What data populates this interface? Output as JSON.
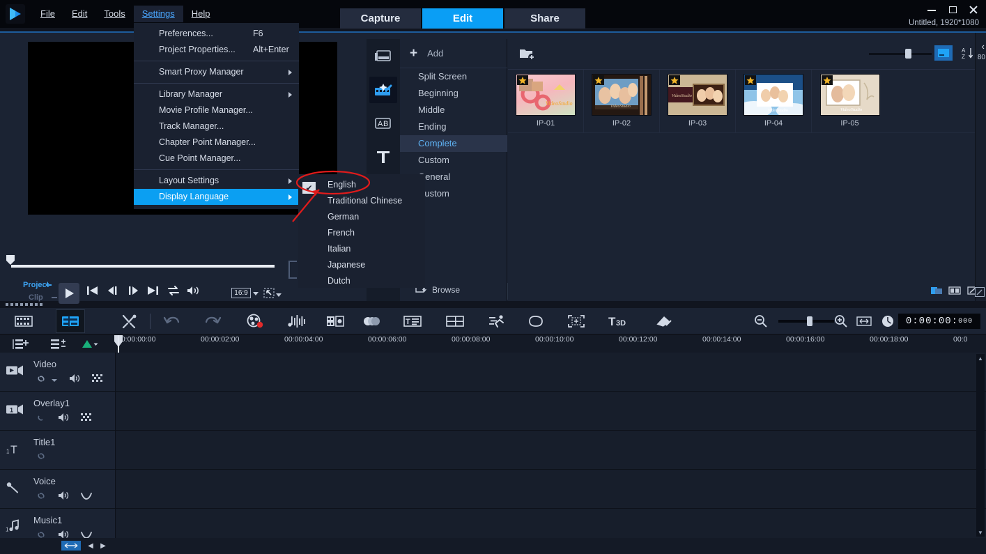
{
  "app": {
    "logo_icon": "play-triangle-logo",
    "project_name": "Untitled, 1920*1080"
  },
  "menubar": {
    "items": [
      {
        "label": "File",
        "active": false
      },
      {
        "label": "Edit",
        "active": false
      },
      {
        "label": "Tools",
        "active": false
      },
      {
        "label": "Settings",
        "active": true
      },
      {
        "label": "Help",
        "active": false
      }
    ]
  },
  "tabs": [
    {
      "label": "Capture",
      "selected": false
    },
    {
      "label": "Edit",
      "selected": true
    },
    {
      "label": "Share",
      "selected": false
    }
  ],
  "window_controls": [
    {
      "name": "minimize-button",
      "icon": "minimize-icon"
    },
    {
      "name": "maximize-button",
      "icon": "maximize-icon"
    },
    {
      "name": "close-button",
      "icon": "close-icon"
    }
  ],
  "settings_menu": {
    "items": [
      {
        "label": "Preferences...",
        "shortcut": "F6",
        "submenu": false,
        "highlight": false
      },
      {
        "label": "Project Properties...",
        "shortcut": "Alt+Enter",
        "submenu": false,
        "highlight": false
      },
      {
        "sep": true
      },
      {
        "label": "Smart Proxy Manager",
        "shortcut": "",
        "submenu": true,
        "highlight": false
      },
      {
        "sep": true
      },
      {
        "label": "Library Manager",
        "shortcut": "",
        "submenu": true,
        "highlight": false
      },
      {
        "label": "Movie Profile Manager...",
        "shortcut": "",
        "submenu": false,
        "highlight": false
      },
      {
        "label": "Track Manager...",
        "shortcut": "",
        "submenu": false,
        "highlight": false
      },
      {
        "label": "Chapter Point Manager...",
        "shortcut": "",
        "submenu": false,
        "highlight": false
      },
      {
        "label": "Cue Point Manager...",
        "shortcut": "",
        "submenu": false,
        "highlight": false
      },
      {
        "sep": true
      },
      {
        "label": "Layout Settings",
        "shortcut": "",
        "submenu": true,
        "highlight": false
      },
      {
        "label": "Display Language",
        "shortcut": "",
        "submenu": true,
        "highlight": true
      }
    ]
  },
  "language_submenu": {
    "items": [
      {
        "label": "English",
        "checked": true
      },
      {
        "label": "Traditional Chinese",
        "checked": false
      },
      {
        "label": "German",
        "checked": false
      },
      {
        "label": "French",
        "checked": false
      },
      {
        "label": "Italian",
        "checked": false
      },
      {
        "label": "Japanese",
        "checked": false
      },
      {
        "label": "Dutch",
        "checked": false
      }
    ],
    "check_glyph": "✔"
  },
  "player": {
    "mode_project": "Project",
    "mode_clip": "Clip",
    "aspect_ratio": "16:9",
    "controls": [
      {
        "name": "play-button",
        "icon": "play-icon"
      },
      {
        "name": "home-button",
        "icon": "skip-start-icon"
      },
      {
        "name": "previous-frame-button",
        "icon": "prev-frame-icon"
      },
      {
        "name": "next-frame-button",
        "icon": "next-frame-icon"
      },
      {
        "name": "end-button",
        "icon": "skip-end-icon"
      },
      {
        "name": "repeat-button",
        "icon": "loop-icon"
      },
      {
        "name": "volume-button",
        "icon": "speaker-icon"
      }
    ]
  },
  "library": {
    "side_icons": [
      {
        "name": "media-icon",
        "selected": false
      },
      {
        "name": "instant-project-icon",
        "selected": true
      },
      {
        "name": "transition-icon",
        "selected": false
      },
      {
        "name": "title-icon",
        "selected": false
      }
    ],
    "add_label": "Add",
    "add_icon": "plus-icon",
    "categories": [
      {
        "label": "Split Screen",
        "selected": false
      },
      {
        "label": "Beginning",
        "selected": false
      },
      {
        "label": "Middle",
        "selected": false
      },
      {
        "label": "Ending",
        "selected": false
      },
      {
        "label": "Complete",
        "selected": true
      },
      {
        "label": "Custom",
        "selected": false
      },
      {
        "label": "General",
        "selected": false
      },
      {
        "label": "Custom",
        "selected": false
      }
    ],
    "browse_label": "Browse",
    "browse_icon": "browse-folder-icon",
    "collapse_icon": "chevron-left-icon"
  },
  "thumbnails": {
    "folder_icon": "add-folder-icon",
    "view_icon": "list-view-icon",
    "sort_icon": "sort-az-icon",
    "items": [
      {
        "name": "IP-01"
      },
      {
        "name": "IP-02"
      },
      {
        "name": "IP-03"
      },
      {
        "name": "IP-04"
      },
      {
        "name": "IP-05"
      }
    ],
    "bottom_buttons": [
      {
        "name": "show-media-button",
        "icon": "media-panel-icon"
      },
      {
        "name": "split-view-button",
        "icon": "split-panel-icon"
      },
      {
        "name": "edit-button",
        "icon": "pencil-square-icon"
      }
    ]
  },
  "right_strip": {
    "chevron": "‹",
    "label": "80",
    "edit_icon": "pencil-square-icon"
  },
  "timeline_toolbar": {
    "icons": [
      {
        "name": "storyboard-view-button",
        "icon": "filmstrip-icon",
        "selected": false
      },
      {
        "name": "timeline-view-button",
        "icon": "timeline-icon",
        "selected": true
      },
      {
        "name": "tools-button",
        "icon": "tools-icon",
        "selected": false
      },
      {
        "name": "undo-button",
        "icon": "undo-icon",
        "selected": false
      },
      {
        "name": "redo-button",
        "icon": "redo-icon",
        "selected": false
      },
      {
        "name": "record-capture-button",
        "icon": "record-film-icon",
        "selected": false
      },
      {
        "name": "audio-mixer-button",
        "icon": "audio-wave-icon",
        "selected": false
      },
      {
        "name": "motion-tracking-button",
        "icon": "motion-track-icon",
        "selected": false
      },
      {
        "name": "multi-camera-button",
        "icon": "multicam-icon",
        "selected": false
      },
      {
        "name": "subtitle-editor-button",
        "icon": "subtitle-icon",
        "selected": false
      },
      {
        "name": "storyboard-grid-button",
        "icon": "grid-icon",
        "selected": false
      },
      {
        "name": "track-transparency-button",
        "icon": "runner-icon",
        "selected": false
      },
      {
        "name": "mask-creator-button",
        "icon": "cloud-mask-icon",
        "selected": false
      },
      {
        "name": "video-tracking-button",
        "icon": "target-brackets-icon",
        "selected": false
      },
      {
        "name": "title-3d-button",
        "icon": "t3d-icon",
        "selected": false
      },
      {
        "name": "paint-creator-button",
        "icon": "paint-brush-icon",
        "selected": false
      },
      {
        "name": "zoom-out-button",
        "icon": "zoom-out-icon",
        "selected": false
      },
      {
        "name": "zoom-in-button",
        "icon": "zoom-in-icon",
        "selected": false
      },
      {
        "name": "fit-project-button",
        "icon": "fit-width-icon",
        "selected": false
      },
      {
        "name": "project-duration-button",
        "icon": "clock-icon",
        "selected": false
      }
    ],
    "t3d_label": "T",
    "t3d_sub": "3D",
    "timecode": "0:00:00:",
    "timecode_ms": "000"
  },
  "timeline": {
    "header_buttons": [
      {
        "name": "track-manager-button",
        "icon": "track-manager-icon"
      },
      {
        "name": "add-remove-track-button",
        "icon": "add-track-icon"
      },
      {
        "name": "mix-view-button",
        "icon": "green-triangle-icon"
      }
    ],
    "ruler_ticks": [
      "00:00:00:00",
      "00:00:02:00",
      "00:00:04:00",
      "00:00:06:00",
      "00:00:08:00",
      "00:00:10:00",
      "00:00:12:00",
      "00:00:14:00",
      "00:00:16:00",
      "00:00:18:00",
      "00:0"
    ],
    "tracks": [
      {
        "name": "Video",
        "icon": "video-track-icon",
        "buttons": [
          "link-icon",
          "chevron-down-icon",
          "speaker-icon",
          "grid-mute-icon"
        ]
      },
      {
        "name": "Overlay1",
        "icon": "overlay-track-icon",
        "buttons": [
          "link-icon",
          "speaker-icon",
          "grid-mute-icon"
        ]
      },
      {
        "name": "Title1",
        "icon": "title-track-icon",
        "buttons": [
          "link-icon"
        ]
      },
      {
        "name": "Voice",
        "icon": "voice-track-icon",
        "buttons": [
          "link-icon",
          "speaker-icon",
          "curve-icon"
        ]
      },
      {
        "name": "Music1",
        "icon": "music-track-icon",
        "buttons": [
          "link-icon",
          "speaker-icon",
          "curve-icon"
        ]
      }
    ],
    "scroll": {
      "fit_button": "fit-to-window-button",
      "left_arrow": "◀",
      "right_arrow": "▶"
    }
  },
  "colors": {
    "accent_blue": "#0b9ff2",
    "tab_selected": "#0a9ef5",
    "panel_bg": "#1b2333",
    "titlebar_bg": "#05070c",
    "annotation_red": "#e01b1b",
    "menu_bg": "#1a2130"
  }
}
